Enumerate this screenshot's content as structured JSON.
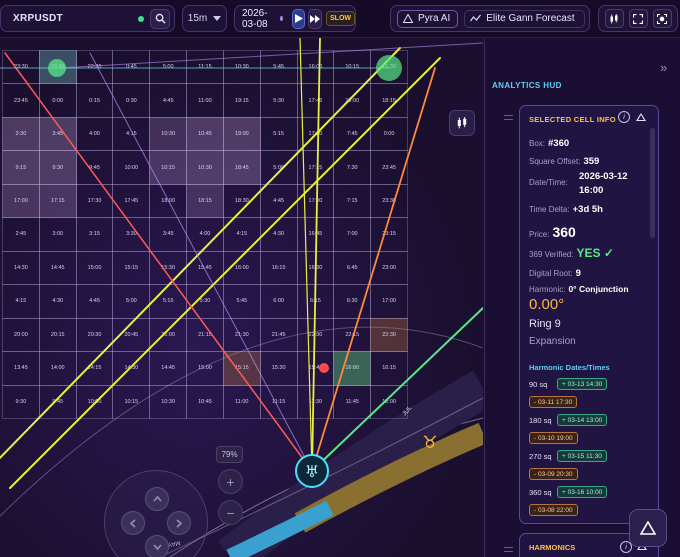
{
  "toolbar": {
    "symbol": "XRPUSDT",
    "timeframe": "15m",
    "date": "2026-03-08",
    "slow_label": "SLOW",
    "pyra_label": "Pyra AI",
    "gann_label": "Elite Gann Forecast"
  },
  "grid": {
    "rows": [
      [
        "23:30",
        "23:45",
        "22:30",
        "0:45",
        "5:00",
        "11:15",
        "10:30",
        "5:45",
        "16:00",
        "10:15",
        "16:30"
      ],
      [
        "23:45",
        "0:00",
        "0:15",
        "0:30",
        "4:45",
        "11:00",
        "19:15",
        "5:30",
        "17:45",
        "18:00",
        "18:15"
      ],
      [
        "3:30",
        "3:45",
        "4:00",
        "4:15",
        "10:30",
        "10:45",
        "19:00",
        "5:15",
        "17:30",
        "7:45",
        "0:00"
      ],
      [
        "9:15",
        "9:30",
        "9:45",
        "10:00",
        "10:15",
        "10:30",
        "18:45",
        "5:00",
        "17:15",
        "7:30",
        "23:45"
      ],
      [
        "17:00",
        "17:15",
        "17:30",
        "17:45",
        "18:00",
        "18:15",
        "18:30",
        "4:45",
        "17:00",
        "7:15",
        "23:30"
      ],
      [
        "2:45",
        "3:00",
        "3:15",
        "3:30",
        "3:45",
        "4:00",
        "4:15",
        "4:30",
        "16:45",
        "7:00",
        "23:15"
      ],
      [
        "14:30",
        "14:45",
        "15:00",
        "15:15",
        "15:30",
        "15:45",
        "16:00",
        "16:15",
        "16:30",
        "6:45",
        "23:00"
      ],
      [
        "4:15",
        "4:30",
        "4:45",
        "5:00",
        "5:15",
        "5:30",
        "5:45",
        "6:00",
        "6:15",
        "6:30",
        "17:00"
      ],
      [
        "20:00",
        "20:15",
        "20:30",
        "20:45",
        "21:00",
        "21:15",
        "21:30",
        "21:45",
        "22:00",
        "22:15",
        "22:30"
      ],
      [
        "13:45",
        "14:00",
        "14:15",
        "14:30",
        "14:45",
        "15:00",
        "15:15",
        "15:30",
        "15:45",
        "16:00",
        "16:15"
      ],
      [
        "9:30",
        "9:45",
        "10:00",
        "10:15",
        "10:30",
        "10:45",
        "11:00",
        "11:15",
        "11:30",
        "11:45",
        "12:00"
      ]
    ]
  },
  "zoom": {
    "percent": "79%"
  },
  "hud": {
    "title": "ANALYTICS HUD",
    "card_title": "SELECTED CELL INFO",
    "box_label": "Box:",
    "box_value": "#360",
    "offset_label": "Square Offset:",
    "offset_value": "359",
    "datetime_label": "Date/Time:",
    "datetime_value_1": "2026-03-12",
    "datetime_value_2": "16:00",
    "delta_label": "Time Delta:",
    "delta_value": "+3d 5h",
    "price_label": "Price:",
    "price_value": "360",
    "verified_label": "369 Verified:",
    "verified_value": "YES ✓",
    "root_label": "Digital Root:",
    "root_value": "9",
    "harmonic_label": "Harmonic:",
    "harmonic_value": "0° Conjunction",
    "degree": "0.00°",
    "ring": "Ring 9",
    "phase": "Expansion",
    "harmonic_dates_title": "Harmonic Dates/Times",
    "harmonic_dates": [
      {
        "sq": "90 sq",
        "plus": "+ 03-13 14:30",
        "minus": "- 03-11 17:30"
      },
      {
        "sq": "180 sq",
        "plus": "+ 03-14 13:00",
        "minus": "- 03-10 19:00"
      },
      {
        "sq": "270 sq",
        "plus": "+ 03-15 11:30",
        "minus": "- 03-09 20:30"
      },
      {
        "sq": "360 sq",
        "plus": "+ 03-16 10:00",
        "minus": "- 03-08 22:00"
      }
    ],
    "harmonics_title": "HARMONICS"
  },
  "chart_labels": {
    "may": "MAY",
    "jul": "JUL",
    "taurus": "♉",
    "uranus": "♅"
  },
  "colors": {
    "accent_cyan": "#5ed0f2",
    "accent_gold": "#ffc24a",
    "verified_green": "#58e88a",
    "line_yellow": "#e8f040",
    "line_red": "#ff5a5a",
    "line_orange": "#ff8a3a",
    "line_green": "#58e888",
    "line_violet": "#b890ff"
  }
}
